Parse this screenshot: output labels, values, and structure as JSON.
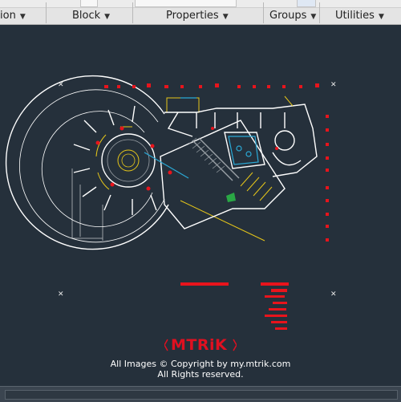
{
  "ribbon": {
    "panels": [
      {
        "label": "ion"
      },
      {
        "label": "Block"
      },
      {
        "label": "Properties"
      },
      {
        "label": "Groups"
      },
      {
        "label": "Utilities"
      }
    ]
  },
  "watermark": {
    "logo": "MTRiK",
    "line1": "All Images © Copyright by my.mtrik.com",
    "line2": "All Rights reserved."
  },
  "colors": {
    "canvas_bg": "#25303b",
    "walls": "#ffffff",
    "annotation_red": "#e8141c",
    "accent_yellow": "#e6c619",
    "accent_cyan": "#2aa9d6",
    "accent_green": "#2aa845",
    "logo_red": "#e01020"
  }
}
